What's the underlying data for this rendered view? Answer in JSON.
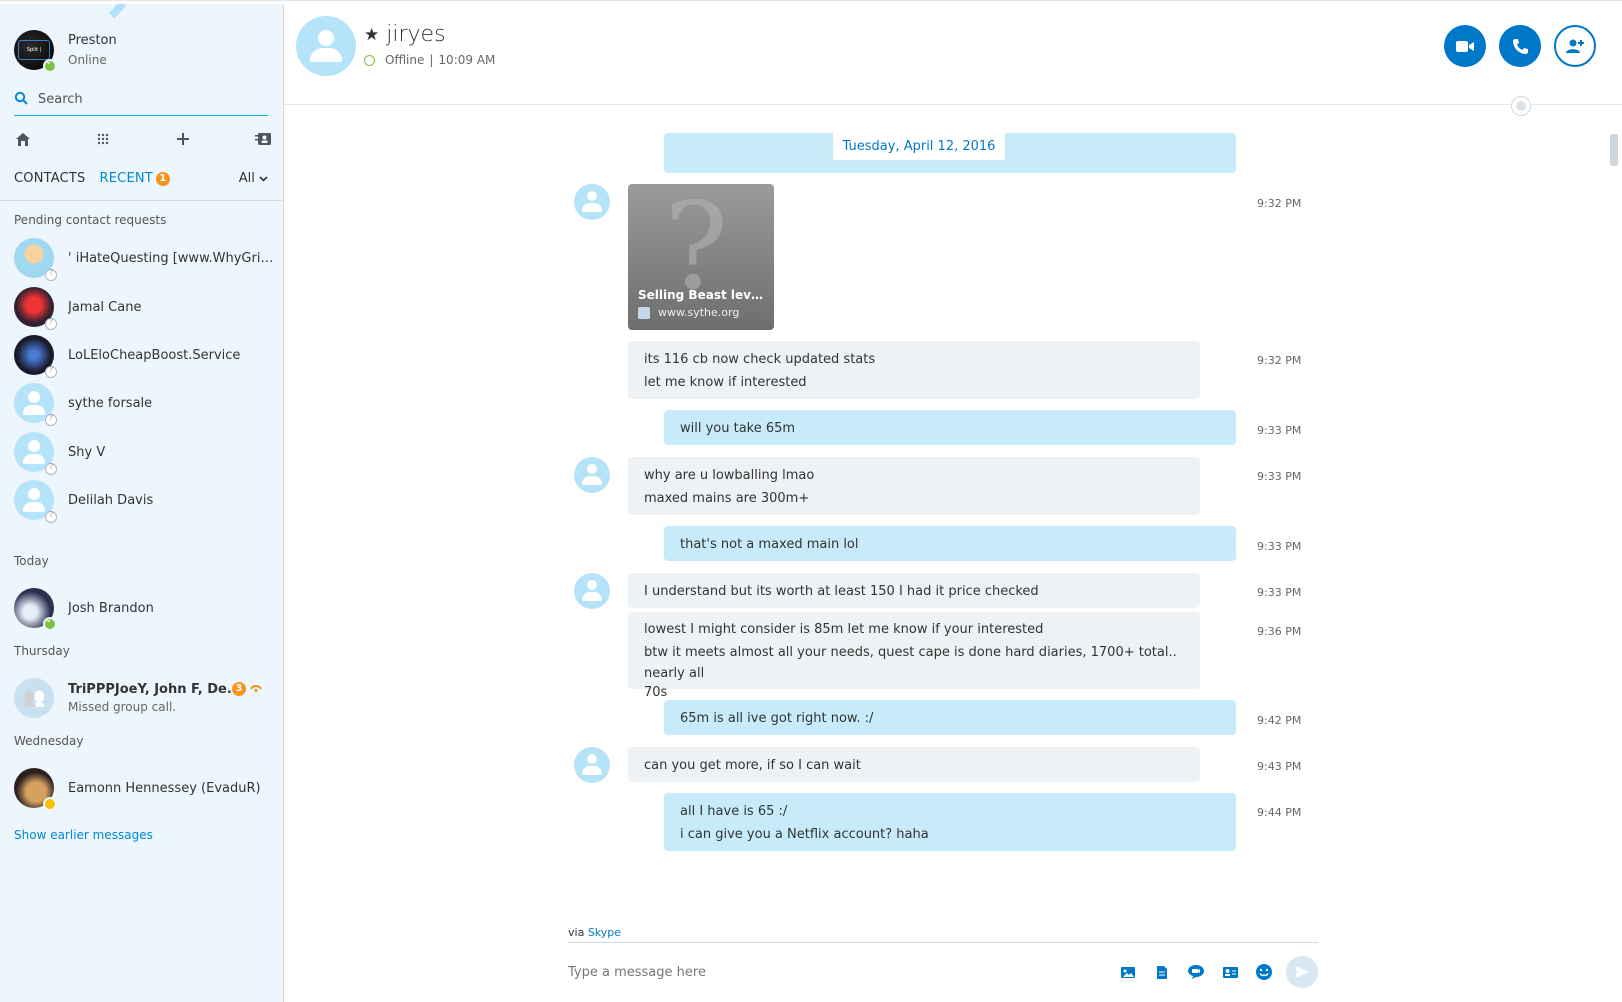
{
  "profile": {
    "name": "Preston",
    "status": "Online",
    "logo_text": "Split | Broadcast"
  },
  "search": {
    "placeholder": "Search"
  },
  "tabs": {
    "contacts": "CONTACTS",
    "recent": "RECENT",
    "recent_badge": "1",
    "filter": "All"
  },
  "sections": {
    "pending": "Pending contact requests",
    "today": "Today",
    "thursday": "Thursday",
    "wednesday": "Wednesday"
  },
  "contacts": [
    {
      "name": "'  iHateQuesting [www.WhyGrin...",
      "presence": "unknown"
    },
    {
      "name": "Jamal Cane",
      "presence": "unknown"
    },
    {
      "name": "LoLEloCheapBoost.Service",
      "presence": "unknown"
    },
    {
      "name": "sythe forsale",
      "presence": "unknown"
    },
    {
      "name": "Shy V",
      "presence": "unknown"
    },
    {
      "name": "Delilah Davis",
      "presence": "unknown"
    },
    {
      "name": "Josh Brandon",
      "presence": "online"
    },
    {
      "name": "TriPPPJoeY, John F, De...",
      "sub": "Missed group call.",
      "badge": "3"
    },
    {
      "name": "Eamonn Hennessey (EvaduR)",
      "presence": "away"
    }
  ],
  "show_earlier": "Show earlier messages",
  "chat": {
    "name": "jiryes",
    "status": "Offline",
    "last_seen": "10:09 AM",
    "status_sep": "|",
    "date": "Tuesday, April 12, 2016"
  },
  "messages": {
    "card": {
      "title": "Selling Beast level...",
      "site": "www.sythe.org",
      "time": "9:32 PM"
    },
    "m1": {
      "lines": [
        "its 116 cb now check updated stats",
        "let me know if interested"
      ],
      "time": "9:32 PM"
    },
    "m2": {
      "lines": [
        "will you take 65m"
      ],
      "time": "9:33 PM"
    },
    "m3": {
      "lines": [
        "why are u lowballing lmao",
        "maxed mains are 300m+"
      ],
      "time": "9:33 PM"
    },
    "m4": {
      "lines": [
        "that's not a maxed main lol"
      ],
      "time": "9:33 PM"
    },
    "m5": {
      "lines": [
        "I understand but its worth at least 150 I had it price checked"
      ],
      "time": "9:33 PM"
    },
    "m6": {
      "lines": [
        "lowest I might consider is 85m let me know if your interested",
        "btw it meets almost all your needs, quest cape is done hard diaries, 1700+ total.. nearly all",
        "70s"
      ],
      "time": "9:36 PM"
    },
    "m7": {
      "lines": [
        "65m is all ive got right now. :/"
      ],
      "time": "9:42 PM"
    },
    "m8": {
      "lines": [
        "can you get more, if so I can wait"
      ],
      "time": "9:43 PM"
    },
    "m9": {
      "lines": [
        "all I have is 65 :/",
        "i can give you a Netflix account? haha"
      ],
      "time": "9:44 PM"
    }
  },
  "compose": {
    "via": "via",
    "via_link": "Skype",
    "placeholder": "Type a message here"
  },
  "colors": {
    "accent": "#0078ca",
    "outgoing": "#c7ebfb",
    "incoming": "#eef2f5",
    "sidebar": "#ecf6fc",
    "online": "#7cc142",
    "badge": "#f7941e"
  },
  "icons": [
    "search-icon",
    "home-icon",
    "dialpad-icon",
    "plus-icon",
    "contacts-book-icon",
    "star-icon",
    "video-call-icon",
    "phone-icon",
    "add-person-icon",
    "globe-icon",
    "image-icon",
    "file-icon",
    "video-message-icon",
    "contact-card-icon",
    "emoticon-icon",
    "send-icon"
  ]
}
